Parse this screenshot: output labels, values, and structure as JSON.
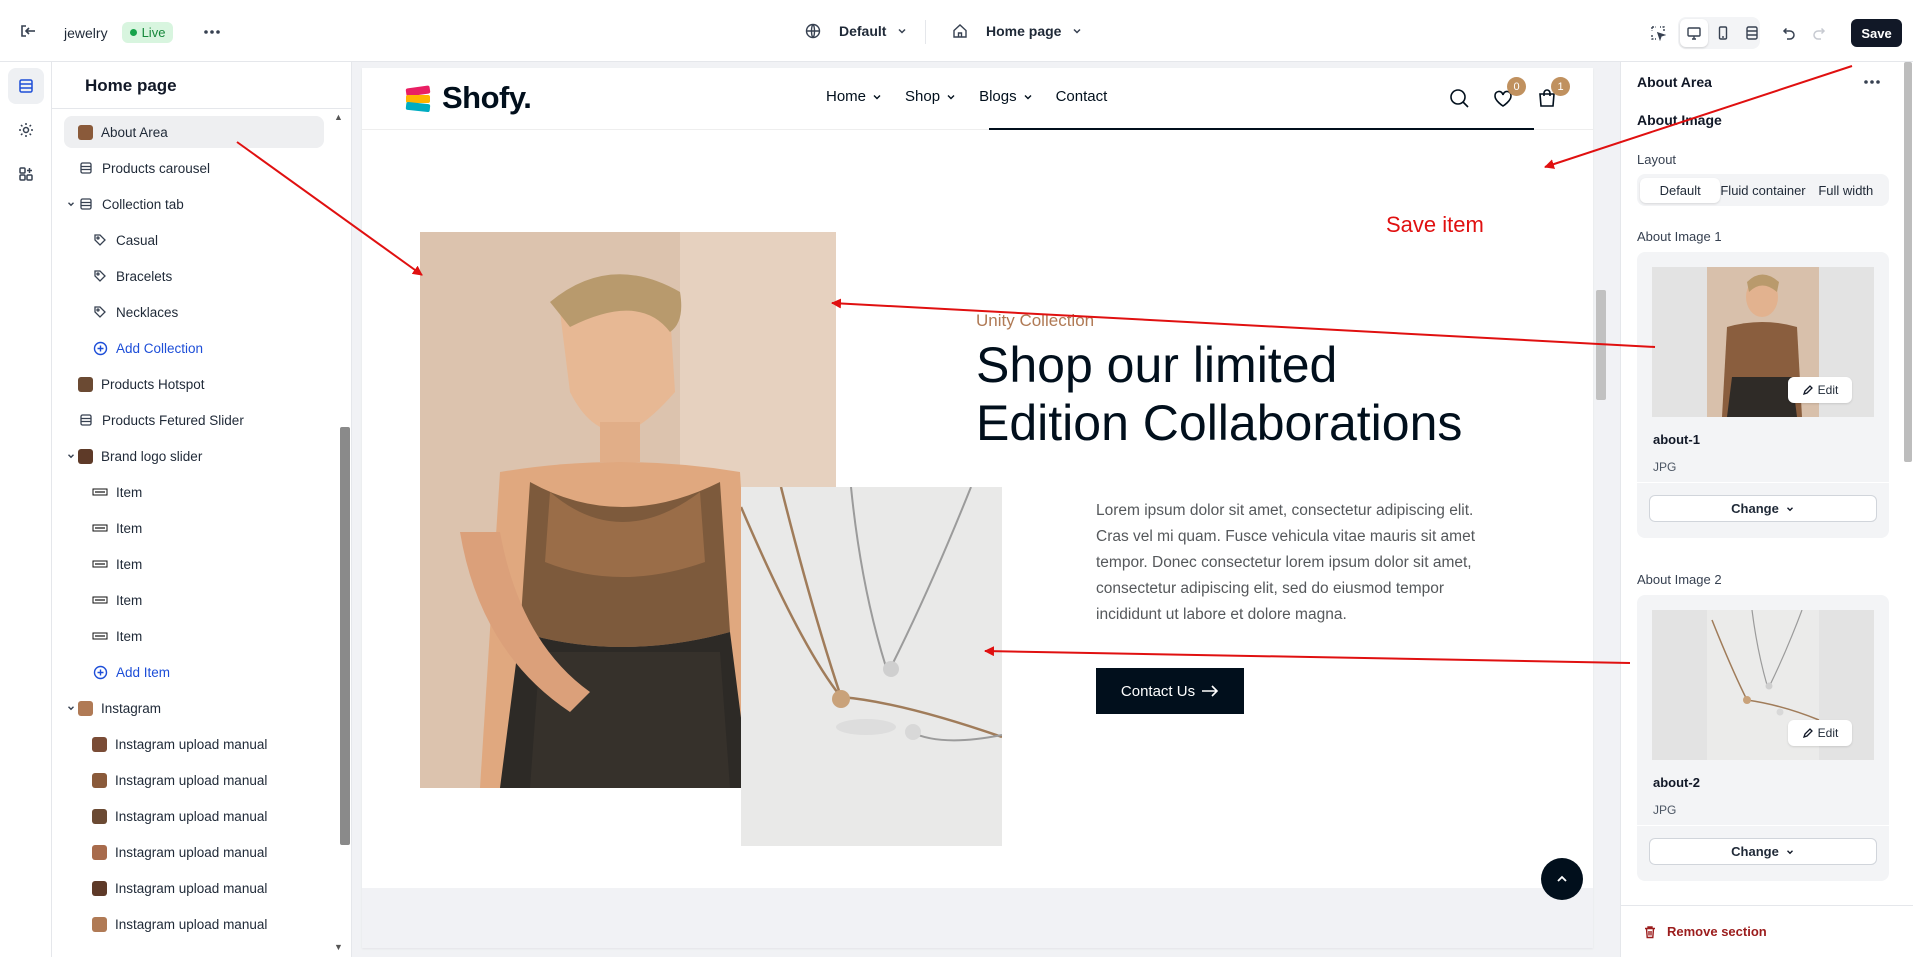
{
  "topbar": {
    "store_name": "jewelry",
    "status": "Live",
    "theme_select": "Default",
    "page_select": "Home page",
    "save_label": "Save"
  },
  "sidebar": {
    "title": "Home page",
    "items": [
      {
        "label": "About Area",
        "icon": "image-thumb",
        "selected": true
      },
      {
        "label": "Products carousel",
        "icon": "section-icon"
      },
      {
        "label": "Collection tab",
        "icon": "section-icon",
        "expanded": true
      },
      {
        "label": "Casual",
        "icon": "tag-icon"
      },
      {
        "label": "Bracelets",
        "icon": "tag-icon"
      },
      {
        "label": "Necklaces",
        "icon": "tag-icon"
      },
      {
        "label": "Add Collection",
        "icon": "plus-circle-icon"
      },
      {
        "label": "Products Hotspot",
        "icon": "image-thumb"
      },
      {
        "label": "Products Fetured Slider",
        "icon": "section-icon"
      },
      {
        "label": "Brand logo slider",
        "icon": "image-thumb",
        "expanded": true
      },
      {
        "label": "Item",
        "icon": "brand-logo-thumb"
      },
      {
        "label": "Item",
        "icon": "brand-logo-thumb"
      },
      {
        "label": "Item",
        "icon": "brand-logo-thumb"
      },
      {
        "label": "Item",
        "icon": "brand-logo-thumb"
      },
      {
        "label": "Item",
        "icon": "brand-logo-thumb"
      },
      {
        "label": "Add Item",
        "icon": "plus-circle-icon"
      },
      {
        "label": "Instagram",
        "icon": "image-thumb",
        "expanded": true
      },
      {
        "label": "Instagram upload manual",
        "icon": "image-thumb"
      },
      {
        "label": "Instagram upload manual",
        "icon": "image-thumb"
      },
      {
        "label": "Instagram upload manual",
        "icon": "image-thumb"
      },
      {
        "label": "Instagram upload manual",
        "icon": "image-thumb"
      },
      {
        "label": "Instagram upload manual",
        "icon": "image-thumb"
      },
      {
        "label": "Instagram upload manual",
        "icon": "image-thumb"
      }
    ]
  },
  "site": {
    "logo_text": "Shofy.",
    "nav": [
      "Home",
      "Shop",
      "Blogs",
      "Contact"
    ],
    "wishlist_count": "0",
    "cart_count": "1",
    "subtitle": "Unity Collection",
    "headline_line1": "Shop our limited",
    "headline_line2": "Edition Collaborations",
    "paragraph": "Lorem ipsum dolor sit amet, consectetur adipiscing elit. Cras vel mi quam. Fusce vehicula vitae mauris sit amet tempor. Donec consectetur lorem ipsum dolor sit amet, consectetur adipiscing elit, sed do eiusmod tempor incididunt ut labore et dolore magna.",
    "cta_label": "Contact Us"
  },
  "panel": {
    "title": "About Area",
    "subtitle": "About Image",
    "layout_label": "Layout",
    "layout_options": [
      "Default",
      "Fluid container",
      "Full width"
    ],
    "layout_selected": "Default",
    "image1": {
      "label": "About Image 1",
      "name": "about-1",
      "type": "JPG",
      "edit_label": "Edit",
      "change_label": "Change"
    },
    "image2": {
      "label": "About Image 2",
      "name": "about-2",
      "type": "JPG",
      "edit_label": "Edit",
      "change_label": "Change"
    },
    "remove_label": "Remove section"
  },
  "annotation": {
    "text": "Save item",
    "color": "#e01010"
  },
  "colors": {
    "brand_dark": "#010f1c",
    "accent_brown": "#c0915f",
    "live_green": "#16a34a",
    "danger": "#9b1c1c"
  }
}
